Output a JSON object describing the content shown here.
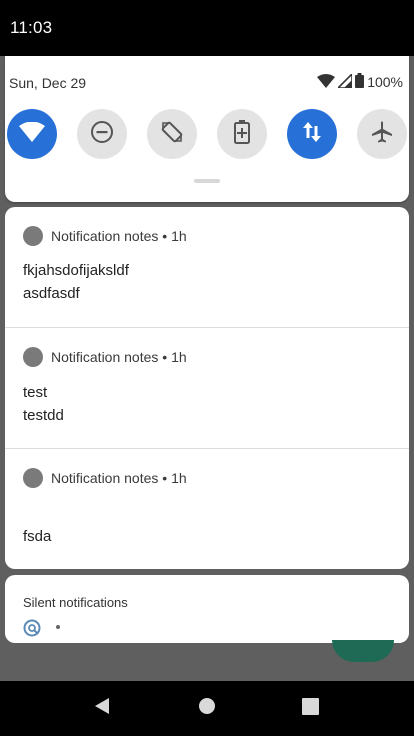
{
  "status_bar": {
    "time": "11:03"
  },
  "quick_settings": {
    "date": "Sun, Dec 29",
    "battery": "100%",
    "tiles": [
      {
        "name": "wifi",
        "icon": "wifi-icon",
        "active": true
      },
      {
        "name": "do-not-disturb",
        "icon": "do-not-disturb-icon",
        "active": false
      },
      {
        "name": "auto-rotate",
        "icon": "auto-rotate-icon",
        "active": false
      },
      {
        "name": "battery-saver",
        "icon": "battery-saver-icon",
        "active": false
      },
      {
        "name": "mobile-data",
        "icon": "mobile-data-icon",
        "active": true
      },
      {
        "name": "airplane-mode",
        "icon": "airplane-icon",
        "active": false
      }
    ]
  },
  "notifications": [
    {
      "app": "Notification notes",
      "sep": "•",
      "time": "1h",
      "title": "fkjahsdofijaksldf",
      "body": "asdfasdf"
    },
    {
      "app": "Notification notes",
      "sep": "•",
      "time": "1h",
      "title": "test",
      "body": "testdd"
    },
    {
      "app": "Notification notes",
      "sep": "•",
      "time": "1h",
      "title": "",
      "body": "fsda"
    }
  ],
  "silent": {
    "title": "Silent notifications"
  },
  "colors": {
    "accent": "#2770d7",
    "tile_off": "#e3e3e3",
    "scrim": "#5f5f5f"
  }
}
